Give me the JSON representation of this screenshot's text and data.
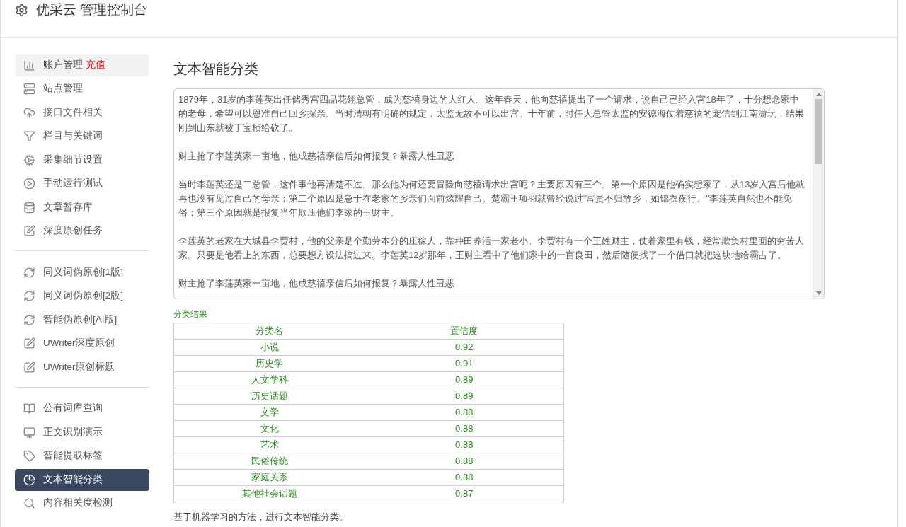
{
  "header": {
    "title": "优采云 管理控制台"
  },
  "sidebar": {
    "groups": [
      {
        "items": [
          {
            "label": "账户管理",
            "badge": "充值",
            "hovered": true,
            "selected": false
          },
          {
            "label": "站点管理",
            "hovered": false,
            "selected": false
          },
          {
            "label": "接口文件相关",
            "hovered": false,
            "selected": false
          },
          {
            "label": "栏目与关键词",
            "hovered": false,
            "selected": false
          },
          {
            "label": "采集细节设置",
            "hovered": false,
            "selected": false
          },
          {
            "label": "手动运行测试",
            "hovered": false,
            "selected": false
          },
          {
            "label": "文章暂存库",
            "hovered": false,
            "selected": false
          },
          {
            "label": "深度原创任务",
            "hovered": false,
            "selected": false
          }
        ]
      },
      {
        "items": [
          {
            "label": "同义词伪原创[1版]",
            "hovered": false,
            "selected": false
          },
          {
            "label": "同义词伪原创[2版]",
            "hovered": false,
            "selected": false
          },
          {
            "label": "智能伪原创[AI版]",
            "hovered": false,
            "selected": false
          },
          {
            "label": "UWriter深度原创",
            "hovered": false,
            "selected": false
          },
          {
            "label": "UWriter原创标题",
            "hovered": false,
            "selected": false
          }
        ]
      },
      {
        "items": [
          {
            "label": "公有词库查询",
            "hovered": false,
            "selected": false
          },
          {
            "label": "正文识别演示",
            "hovered": false,
            "selected": false
          },
          {
            "label": "智能提取标签",
            "hovered": false,
            "selected": false
          },
          {
            "label": "文本智能分类",
            "hovered": false,
            "selected": true
          },
          {
            "label": "内容相关度检测",
            "hovered": false,
            "selected": false
          }
        ]
      }
    ]
  },
  "main": {
    "title": "文本智能分类",
    "text_paragraphs": [
      "1879年，31岁的李莲英出任储秀宫四品花翎总管，成为慈禧身边的大红人。这年春天，他向慈禧提出了一个请求，说自己已经入宫18年了，十分想念家中的老母，希望可以恩准自己回乡探亲。当时清朝有明确的规定，太监无故不可以出宫。十年前，时任大总管太监的安德海仗着慈禧的宠信到江南游玩，结果刚到山东就被丁宝桢给砍了。",
      "财主抢了李莲英家一亩地，他成慈禧亲信后如何报复？暴露人性丑恶",
      "当时李莲英还是二总管，这件事他再清楚不过。那么他为何还要冒险向慈禧请求出宫呢？主要原因有三个。第一个原因是他确实想家了，从13岁入宫后他就再也没有见过自己的母亲；第二个原因是急于在老家的乡亲们面前炫耀自己。楚霸王项羽就曾经说过“富贵不归故乡，如锦衣夜行。”李莲英自然也不能免俗；第三个原因就是报复当年欺压他们李家的王财主。",
      "李莲英的老家在大城县李贾村，他的父亲是个勤劳本分的庄稼人，靠种田养活一家老小。李贾村有一个王姓财主，仗着家里有钱，经常欺负村里面的穷苦人家。只要是他看上的东西，总要想方设法搞过来。李莲英12岁那年，王财主看中了他们家中的一亩良田，然后随便找了一个借口就把这块地给霸占了。",
      "财主抢了李莲英家一亩地，他成慈禧亲信后如何报复？暴露人性丑恶"
    ],
    "result_label": "分类结果",
    "table": {
      "columns": [
        "分类名",
        "置信度"
      ],
      "rows": [
        [
          "小说",
          "0.92"
        ],
        [
          "历史学",
          "0.91"
        ],
        [
          "人文学科",
          "0.89"
        ],
        [
          "历史话题",
          "0.89"
        ],
        [
          "文学",
          "0.88"
        ],
        [
          "文化",
          "0.88"
        ],
        [
          "艺术",
          "0.88"
        ],
        [
          "民俗传统",
          "0.88"
        ],
        [
          "家庭关系",
          "0.88"
        ],
        [
          "其他社会话题",
          "0.87"
        ]
      ]
    },
    "footnote": "基于机器学习的方法，进行文本智能分类。"
  }
}
